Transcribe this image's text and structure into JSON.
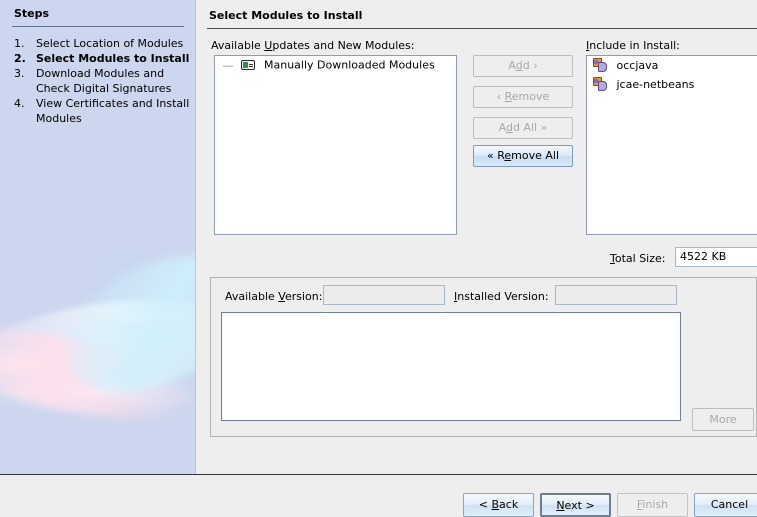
{
  "sidebar": {
    "title": "Steps",
    "steps": [
      {
        "num": "1.",
        "label": "Select Location of Modules",
        "current": false
      },
      {
        "num": "2.",
        "label": "Select Modules to Install",
        "current": true
      },
      {
        "num": "3.",
        "label": "Download Modules and Check Digital Signatures",
        "current": false
      },
      {
        "num": "4.",
        "label": "View Certificates and Install Modules",
        "current": false
      }
    ]
  },
  "main": {
    "title": "Select Modules to Install",
    "available": {
      "label": "Available Updates and New Modules:",
      "tree": [
        {
          "handle": "—",
          "icon": "category-icon",
          "label": "Manually Downloaded Modules"
        }
      ]
    },
    "transfer_buttons": [
      {
        "name": "add-button",
        "label": "Add ›",
        "enabled": false
      },
      {
        "name": "remove-button",
        "label": "‹ Remove",
        "enabled": false
      },
      {
        "name": "add-all-button",
        "label": "Add All »",
        "enabled": false
      },
      {
        "name": "remove-all-button",
        "label": "« Remove All",
        "enabled": true
      }
    ],
    "include": {
      "label": "Include in Install:",
      "items": [
        {
          "icon": "module-icon",
          "label": "occjava"
        },
        {
          "icon": "module-icon",
          "label": "jcae-netbeans"
        }
      ]
    },
    "total_size": {
      "label": "Total Size:",
      "value": "4522 KB"
    },
    "versions": {
      "available_label": "Available Version:",
      "available_value": "",
      "installed_label": "Installed Version:",
      "installed_value": ""
    },
    "description_text": "",
    "more_button": {
      "label": "More",
      "enabled": false
    }
  },
  "footer": {
    "buttons": [
      {
        "name": "back-button",
        "label": "< Back",
        "state": "enabled"
      },
      {
        "name": "next-button",
        "label": "Next >",
        "state": "focused"
      },
      {
        "name": "finish-button",
        "label": "Finish",
        "state": "disabled"
      },
      {
        "name": "cancel-button",
        "label": "Cancel",
        "state": "enabled"
      }
    ]
  },
  "colors": {
    "sidebar_bg": "#ccd6ee",
    "panel_bg": "#eeeeee",
    "list_bg": "#ffffff",
    "button_accent": "#c8dcf2",
    "border": "#8f9bb0"
  }
}
